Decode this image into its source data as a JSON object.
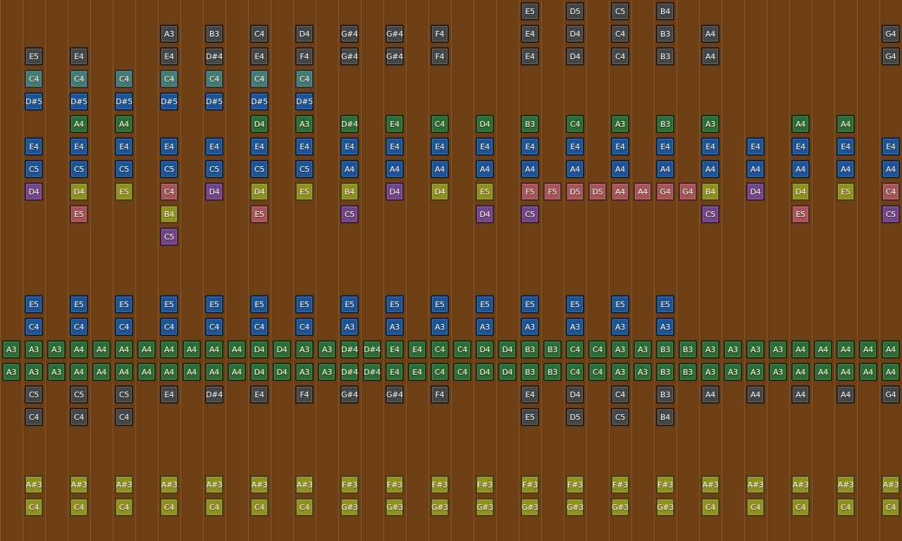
{
  "palette": {
    "gray": "#3b3b3b",
    "teal": "#3e726c",
    "blue": "#114a8e",
    "green": "#236326",
    "purple": "#6b3a80",
    "olive": "#8a8a12",
    "pink": "#a34b4b"
  },
  "tracks": [
    {
      "color": "gray",
      "row": 0,
      "notes": [
        [
          23,
          "E5"
        ],
        [
          25,
          "D5"
        ],
        [
          27,
          "C5"
        ],
        [
          29,
          "B4"
        ]
      ]
    },
    {
      "color": "gray",
      "row": 1,
      "notes": [
        [
          7,
          "A3"
        ],
        [
          9,
          "B3"
        ],
        [
          11,
          "C4"
        ],
        [
          13,
          "D4"
        ],
        [
          15,
          "G#4"
        ],
        [
          17,
          "G#4"
        ],
        [
          19,
          "F4"
        ],
        [
          23,
          "E4"
        ],
        [
          25,
          "D4"
        ],
        [
          27,
          "C4"
        ],
        [
          29,
          "B3"
        ],
        [
          31,
          "A4"
        ],
        [
          39,
          "G4"
        ]
      ]
    },
    {
      "color": "gray",
      "row": 2,
      "notes": [
        [
          1,
          "E5"
        ],
        [
          3,
          "E4"
        ],
        [
          7,
          "E4"
        ],
        [
          9,
          "D#4"
        ],
        [
          11,
          "E4"
        ],
        [
          13,
          "F4"
        ],
        [
          15,
          "G#4"
        ],
        [
          17,
          "G#4"
        ],
        [
          19,
          "F4"
        ],
        [
          23,
          "E4"
        ],
        [
          25,
          "D4"
        ],
        [
          27,
          "C4"
        ],
        [
          29,
          "B3"
        ],
        [
          31,
          "A4"
        ],
        [
          39,
          "G4"
        ]
      ]
    },
    {
      "color": "teal",
      "row": 3,
      "notes": [
        [
          1,
          "C4"
        ],
        [
          3,
          "C4"
        ],
        [
          5,
          "C4"
        ],
        [
          7,
          "C4"
        ],
        [
          9,
          "C4"
        ],
        [
          11,
          "C4"
        ],
        [
          13,
          "C4"
        ]
      ]
    },
    {
      "color": "blue",
      "row": 4,
      "notes": [
        [
          1,
          "D#5"
        ],
        [
          3,
          "D#5"
        ],
        [
          5,
          "D#5"
        ],
        [
          7,
          "D#5"
        ],
        [
          9,
          "D#5"
        ],
        [
          11,
          "D#5"
        ],
        [
          13,
          "D#5"
        ]
      ]
    },
    {
      "color": "green",
      "row": 5,
      "notes": [
        [
          3,
          "A4"
        ],
        [
          5,
          "A4"
        ],
        [
          11,
          "D4"
        ],
        [
          13,
          "A3"
        ],
        [
          15,
          "D#4"
        ],
        [
          17,
          "E4"
        ],
        [
          19,
          "C4"
        ],
        [
          21,
          "D4"
        ],
        [
          23,
          "B3"
        ],
        [
          25,
          "C4"
        ],
        [
          27,
          "A3"
        ],
        [
          29,
          "B3"
        ],
        [
          31,
          "A3"
        ],
        [
          35,
          "A4"
        ],
        [
          37,
          "A4"
        ]
      ]
    },
    {
      "color": "blue",
      "row": 6,
      "notes": [
        [
          1,
          "E4"
        ],
        [
          3,
          "E4"
        ],
        [
          5,
          "E4"
        ],
        [
          7,
          "E4"
        ],
        [
          9,
          "E4"
        ],
        [
          11,
          "E4"
        ],
        [
          13,
          "E4"
        ],
        [
          15,
          "E4"
        ],
        [
          17,
          "E4"
        ],
        [
          19,
          "E4"
        ],
        [
          21,
          "E4"
        ],
        [
          23,
          "E4"
        ],
        [
          25,
          "E4"
        ],
        [
          27,
          "E4"
        ],
        [
          29,
          "E4"
        ],
        [
          31,
          "E4"
        ],
        [
          33,
          "E4"
        ],
        [
          35,
          "E4"
        ],
        [
          37,
          "E4"
        ],
        [
          39,
          "E4"
        ]
      ]
    },
    {
      "color": "blue",
      "row": 7,
      "notes": [
        [
          1,
          "C5"
        ],
        [
          3,
          "C5"
        ],
        [
          5,
          "C5"
        ],
        [
          7,
          "C5"
        ],
        [
          9,
          "C5"
        ],
        [
          11,
          "C5"
        ],
        [
          13,
          "C5"
        ],
        [
          15,
          "A4"
        ],
        [
          17,
          "A4"
        ],
        [
          19,
          "A4"
        ],
        [
          21,
          "A4"
        ],
        [
          23,
          "A4"
        ],
        [
          25,
          "A4"
        ],
        [
          27,
          "A4"
        ],
        [
          29,
          "A4"
        ],
        [
          31,
          "A4"
        ],
        [
          33,
          "A4"
        ],
        [
          35,
          "A4"
        ],
        [
          37,
          "A4"
        ],
        [
          39,
          "A4"
        ]
      ]
    },
    {
      "color": "purple",
      "row": 8,
      "notes": [
        [
          1,
          "D4"
        ],
        [
          9,
          "D4"
        ],
        [
          17,
          "D4"
        ],
        [
          33,
          "D4"
        ]
      ]
    },
    {
      "color": "olive",
      "row": 8,
      "notes": [
        [
          3,
          "D4"
        ],
        [
          5,
          "E5"
        ],
        [
          11,
          "D4"
        ],
        [
          13,
          "E5"
        ],
        [
          15,
          "B4"
        ],
        [
          19,
          "D4"
        ],
        [
          21,
          "E5"
        ],
        [
          31,
          "B4"
        ],
        [
          35,
          "D4"
        ],
        [
          37,
          "E5"
        ]
      ]
    },
    {
      "color": "pink",
      "row": 8,
      "notes": [
        [
          7,
          "C4"
        ],
        [
          23,
          "F5"
        ],
        [
          24,
          "F5"
        ],
        [
          25,
          "D5"
        ],
        [
          26,
          "D5"
        ],
        [
          27,
          "A4"
        ],
        [
          28,
          "A4"
        ],
        [
          29,
          "G4"
        ],
        [
          30,
          "G4"
        ],
        [
          39,
          "C4"
        ]
      ]
    },
    {
      "color": "pink",
      "row": 9,
      "notes": [
        [
          3,
          "E5"
        ],
        [
          11,
          "E5"
        ],
        [
          35,
          "E5"
        ]
      ]
    },
    {
      "color": "olive",
      "row": 9,
      "notes": [
        [
          7,
          "B4"
        ]
      ]
    },
    {
      "color": "purple",
      "row": 9,
      "notes": [
        [
          15,
          "C5"
        ],
        [
          21,
          "D4"
        ],
        [
          23,
          "C5"
        ],
        [
          31,
          "C5"
        ],
        [
          39,
          "C5"
        ]
      ]
    },
    {
      "color": "purple",
      "row": 10,
      "notes": [
        [
          7,
          "C5"
        ]
      ]
    },
    {
      "color": "blue",
      "row": 13,
      "notes": [
        [
          1,
          "E5"
        ],
        [
          3,
          "E5"
        ],
        [
          5,
          "E5"
        ],
        [
          7,
          "E5"
        ],
        [
          9,
          "E5"
        ],
        [
          11,
          "E5"
        ],
        [
          13,
          "E5"
        ],
        [
          15,
          "E5"
        ],
        [
          17,
          "E5"
        ],
        [
          19,
          "E5"
        ],
        [
          21,
          "E5"
        ],
        [
          23,
          "E5"
        ],
        [
          25,
          "E5"
        ],
        [
          27,
          "E5"
        ],
        [
          29,
          "E5"
        ]
      ]
    },
    {
      "color": "blue",
      "row": 14,
      "notes": [
        [
          1,
          "C4"
        ],
        [
          3,
          "C4"
        ],
        [
          5,
          "C4"
        ],
        [
          7,
          "C4"
        ],
        [
          9,
          "C4"
        ],
        [
          11,
          "C4"
        ],
        [
          13,
          "C4"
        ],
        [
          15,
          "A3"
        ],
        [
          17,
          "A3"
        ],
        [
          19,
          "A3"
        ],
        [
          21,
          "A3"
        ],
        [
          23,
          "A3"
        ],
        [
          25,
          "A3"
        ],
        [
          27,
          "A3"
        ],
        [
          29,
          "A3"
        ]
      ]
    },
    {
      "color": "green",
      "row": 15,
      "notes": [
        [
          0,
          "A3"
        ],
        [
          1,
          "A3"
        ],
        [
          2,
          "A3"
        ],
        [
          3,
          "A4"
        ],
        [
          4,
          "A4"
        ],
        [
          5,
          "A4"
        ],
        [
          6,
          "A4"
        ],
        [
          7,
          "A4"
        ],
        [
          8,
          "A4"
        ],
        [
          9,
          "A4"
        ],
        [
          10,
          "A4"
        ],
        [
          11,
          "D4"
        ],
        [
          12,
          "D4"
        ],
        [
          13,
          "A3"
        ],
        [
          14,
          "A3"
        ],
        [
          15,
          "D#4"
        ],
        [
          16,
          "D#4"
        ],
        [
          17,
          "E4"
        ],
        [
          18,
          "E4"
        ],
        [
          19,
          "C4"
        ],
        [
          20,
          "C4"
        ],
        [
          21,
          "D4"
        ],
        [
          22,
          "D4"
        ],
        [
          23,
          "B3"
        ],
        [
          24,
          "B3"
        ],
        [
          25,
          "C4"
        ],
        [
          26,
          "C4"
        ],
        [
          27,
          "A3"
        ],
        [
          28,
          "A3"
        ],
        [
          29,
          "B3"
        ],
        [
          30,
          "B3"
        ],
        [
          31,
          "A3"
        ],
        [
          32,
          "A3"
        ],
        [
          33,
          "A3"
        ],
        [
          34,
          "A3"
        ],
        [
          35,
          "A4"
        ],
        [
          36,
          "A4"
        ],
        [
          37,
          "A4"
        ],
        [
          38,
          "A4"
        ],
        [
          39,
          "A4"
        ]
      ]
    },
    {
      "color": "green",
      "row": 16,
      "notes": [
        [
          0,
          "A3"
        ],
        [
          1,
          "A3"
        ],
        [
          2,
          "A3"
        ],
        [
          3,
          "A4"
        ],
        [
          4,
          "A4"
        ],
        [
          5,
          "A4"
        ],
        [
          6,
          "A4"
        ],
        [
          7,
          "A4"
        ],
        [
          8,
          "A4"
        ],
        [
          9,
          "A4"
        ],
        [
          10,
          "A4"
        ],
        [
          11,
          "D4"
        ],
        [
          12,
          "D4"
        ],
        [
          13,
          "A3"
        ],
        [
          14,
          "A3"
        ],
        [
          15,
          "D#4"
        ],
        [
          16,
          "D#4"
        ],
        [
          17,
          "E4"
        ],
        [
          18,
          "E4"
        ],
        [
          19,
          "C4"
        ],
        [
          20,
          "C4"
        ],
        [
          21,
          "D4"
        ],
        [
          22,
          "D4"
        ],
        [
          23,
          "B3"
        ],
        [
          24,
          "B3"
        ],
        [
          25,
          "C4"
        ],
        [
          26,
          "C4"
        ],
        [
          27,
          "A3"
        ],
        [
          28,
          "A3"
        ],
        [
          29,
          "B3"
        ],
        [
          30,
          "B3"
        ],
        [
          31,
          "A3"
        ],
        [
          32,
          "A3"
        ],
        [
          33,
          "A3"
        ],
        [
          34,
          "A3"
        ],
        [
          35,
          "A4"
        ],
        [
          36,
          "A4"
        ],
        [
          37,
          "A4"
        ],
        [
          38,
          "A4"
        ],
        [
          39,
          "A4"
        ]
      ]
    },
    {
      "color": "gray",
      "row": 17,
      "notes": [
        [
          1,
          "C5"
        ],
        [
          3,
          "C5"
        ],
        [
          5,
          "C5"
        ],
        [
          7,
          "E4"
        ],
        [
          9,
          "D#4"
        ],
        [
          11,
          "E4"
        ],
        [
          13,
          "F4"
        ],
        [
          15,
          "G#4"
        ],
        [
          17,
          "G#4"
        ],
        [
          19,
          "F4"
        ],
        [
          23,
          "E4"
        ],
        [
          25,
          "D4"
        ],
        [
          27,
          "C4"
        ],
        [
          29,
          "B3"
        ],
        [
          31,
          "A4"
        ],
        [
          33,
          "A4"
        ],
        [
          35,
          "A4"
        ],
        [
          37,
          "A4"
        ],
        [
          39,
          "G4"
        ]
      ]
    },
    {
      "color": "gray",
      "row": 18,
      "notes": [
        [
          1,
          "C4"
        ],
        [
          3,
          "C4"
        ],
        [
          5,
          "C4"
        ],
        [
          23,
          "E5"
        ],
        [
          25,
          "D5"
        ],
        [
          27,
          "C5"
        ],
        [
          29,
          "B4"
        ]
      ]
    },
    {
      "color": "olive",
      "row": 21,
      "notes": [
        [
          1,
          "A#3"
        ],
        [
          3,
          "A#3"
        ],
        [
          5,
          "A#3"
        ],
        [
          7,
          "A#3"
        ],
        [
          9,
          "A#3"
        ],
        [
          11,
          "A#3"
        ],
        [
          13,
          "A#3"
        ],
        [
          15,
          "F#3"
        ],
        [
          17,
          "F#3"
        ],
        [
          19,
          "F#3"
        ],
        [
          21,
          "F#3"
        ],
        [
          23,
          "F#3"
        ],
        [
          25,
          "F#3"
        ],
        [
          27,
          "F#3"
        ],
        [
          29,
          "F#3"
        ],
        [
          31,
          "A#3"
        ],
        [
          33,
          "A#3"
        ],
        [
          35,
          "A#3"
        ],
        [
          37,
          "A#3"
        ],
        [
          39,
          "A#3"
        ]
      ]
    },
    {
      "color": "olive",
      "row": 22,
      "notes": [
        [
          1,
          "C4"
        ],
        [
          3,
          "C4"
        ],
        [
          5,
          "C4"
        ],
        [
          7,
          "C4"
        ],
        [
          9,
          "C4"
        ],
        [
          11,
          "C4"
        ],
        [
          13,
          "C4"
        ],
        [
          15,
          "G#3"
        ],
        [
          17,
          "G#3"
        ],
        [
          19,
          "G#3"
        ],
        [
          21,
          "G#3"
        ],
        [
          23,
          "G#3"
        ],
        [
          25,
          "G#3"
        ],
        [
          27,
          "G#3"
        ],
        [
          29,
          "G#3"
        ],
        [
          31,
          "C4"
        ],
        [
          33,
          "C4"
        ],
        [
          35,
          "C4"
        ],
        [
          37,
          "C4"
        ],
        [
          39,
          "C4"
        ]
      ]
    }
  ]
}
